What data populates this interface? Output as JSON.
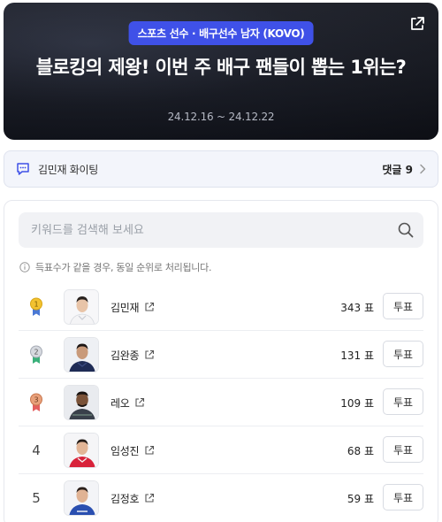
{
  "hero": {
    "tag": "스포츠 선수 · 배구선수 남자 (KOVO)",
    "title": "블로킹의 제왕! 이번 주 배구 팬들이 뽑는 1위는?",
    "date_range": "24.12.16 ~ 24.12.22",
    "share_icon": "share-external-icon"
  },
  "cheer": {
    "label": "김민재 화이팅",
    "comment_count": "댓글 9",
    "icon": "chat-bubble-icon"
  },
  "search": {
    "placeholder": "키워드를 검색해 보세요",
    "value": ""
  },
  "notice": {
    "text": "득표수가 같을 경우, 동일 순위로 처리됩니다."
  },
  "players": [
    {
      "rank": "1",
      "medal": "gold",
      "name": "김민재",
      "votes": "343 표",
      "vote_label": "투표",
      "jersey": "#f4f4f6",
      "jersey_accent": "#c8cbd3"
    },
    {
      "rank": "2",
      "medal": "silver",
      "name": "김완종",
      "votes": "131 표",
      "vote_label": "투표",
      "jersey": "#1e2b55",
      "jersey_accent": "#3a4a80"
    },
    {
      "rank": "3",
      "medal": "bronze",
      "name": "레오",
      "votes": "109 표",
      "vote_label": "투표",
      "jersey": "#39404a",
      "jersey_accent": "#5b6e6a"
    },
    {
      "rank": "4",
      "medal": "",
      "name": "임성진",
      "votes": "68 표",
      "vote_label": "투표",
      "jersey": "#d8223a",
      "jersey_accent": "#f2f2f2"
    },
    {
      "rank": "5",
      "medal": "",
      "name": "김정호",
      "votes": "59 표",
      "vote_label": "투표",
      "jersey": "#2a4fb0",
      "jersey_accent": "#e9edf5"
    }
  ],
  "colors": {
    "tag_bg": "#3f51e8",
    "gold": "#f2c230",
    "silver": "#b8bcc6",
    "bronze": "#e9a07a",
    "ribbon_gold": "#4a78d4",
    "ribbon_silver": "#3ab07a",
    "ribbon_bronze": "#e45e5e"
  }
}
